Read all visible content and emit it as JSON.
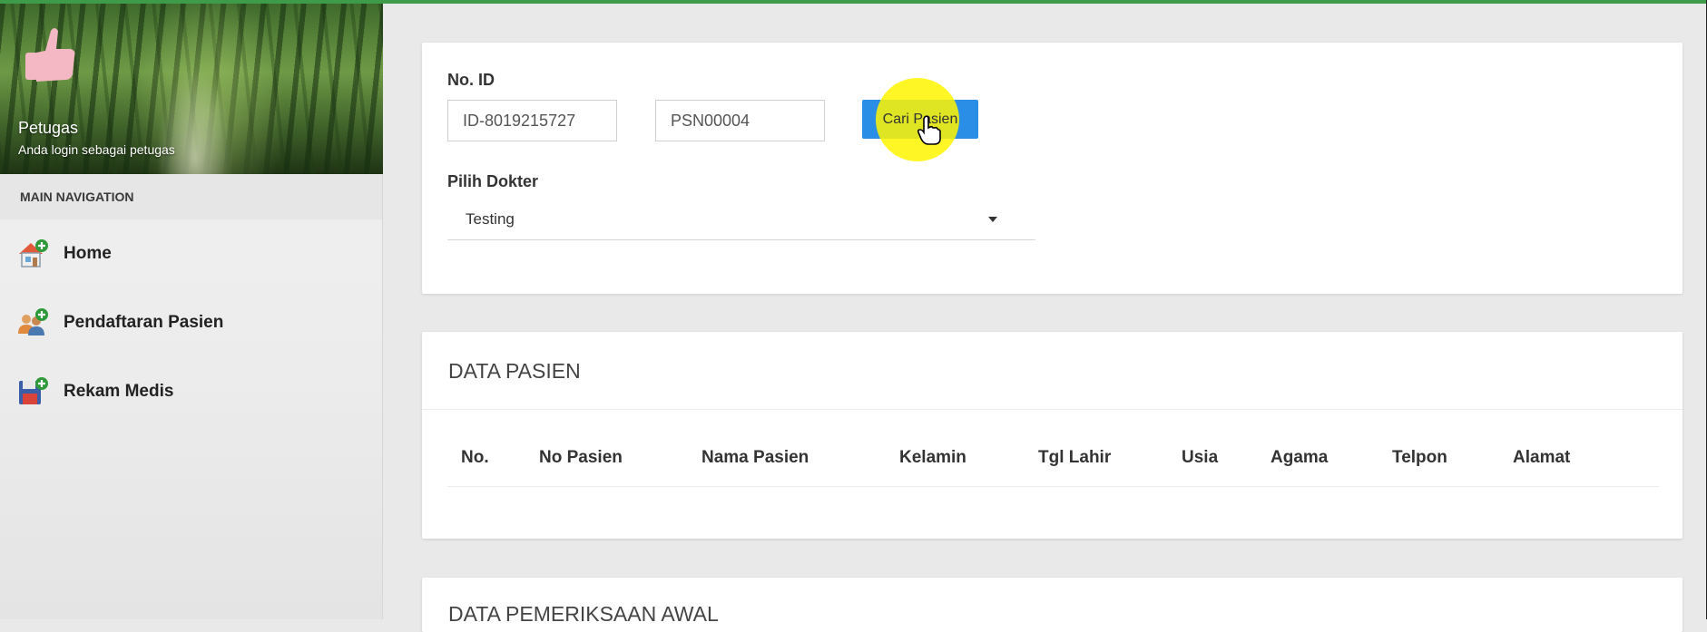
{
  "sidebar": {
    "user_name": "Petugas",
    "user_role": "Anda login sebagai petugas",
    "nav_header": "MAIN NAVIGATION",
    "items": [
      {
        "label": "Home",
        "icon": "home-add-icon"
      },
      {
        "label": "Pendaftaran Pasien",
        "icon": "users-add-icon"
      },
      {
        "label": "Rekam Medis",
        "icon": "save-add-icon"
      }
    ]
  },
  "search": {
    "id_label": "No. ID",
    "id_value": "ID-8019215727",
    "patient_value": "PSN00004",
    "search_button": "Cari Pasien",
    "doctor_label": "Pilih Dokter",
    "doctor_selected": "Testing"
  },
  "data_pasien": {
    "title": "DATA PASIEN",
    "columns": [
      "No.",
      "No Pasien",
      "Nama Pasien",
      "Kelamin",
      "Tgl Lahir",
      "Usia",
      "Agama",
      "Telpon",
      "Alamat"
    ]
  },
  "data_pemeriksaan": {
    "title": "DATA PEMERIKSAAN AWAL"
  },
  "colors": {
    "accent": "#3d9b4a",
    "button": "#2a8ee6",
    "highlight": "#fff500"
  }
}
